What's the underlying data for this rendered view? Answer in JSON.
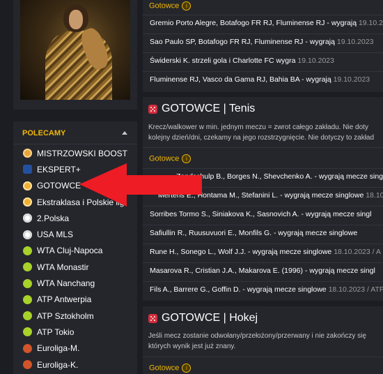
{
  "sidebar": {
    "title": "POLECAMY",
    "items": [
      {
        "label": "MISTRZOWSKI BOOST",
        "icon": "boost-icon"
      },
      {
        "label": "EKSPERT+",
        "icon": "ekspert-icon"
      },
      {
        "label": "GOTOWCE",
        "icon": "gotowce-icon"
      },
      {
        "label": "Ekstraklasa i Polskie lig",
        "icon": "gotowce-icon"
      },
      {
        "label": "2.Polska",
        "icon": "football-icon"
      },
      {
        "label": "USA MLS",
        "icon": "football-icon"
      },
      {
        "label": "WTA Cluj-Napoca",
        "icon": "tennis-ball-icon"
      },
      {
        "label": "WTA Monastir",
        "icon": "tennis-ball-icon"
      },
      {
        "label": "WTA Nanchang",
        "icon": "tennis-ball-icon"
      },
      {
        "label": "ATP Antwerpia",
        "icon": "tennis-ball-icon"
      },
      {
        "label": "ATP Sztokholm",
        "icon": "tennis-ball-icon"
      },
      {
        "label": "ATP Tokio",
        "icon": "tennis-ball-icon"
      },
      {
        "label": "Euroliga-M.",
        "icon": "basketball-icon"
      },
      {
        "label": "Euroliga-K.",
        "icon": "basketball-icon"
      }
    ]
  },
  "football_section": {
    "gotowce_label": "Gotowce",
    "info_glyph": "i",
    "rows": [
      {
        "text": "Gremio Porto Alegre, Botafogo FR RJ, Fluminense RJ - wygrają",
        "date": "19.10.20"
      },
      {
        "text": "Sao Paulo SP, Botafogo FR RJ, Fluminense RJ - wygrają",
        "date": "19.10.2023"
      },
      {
        "text": "Świderski K. strzeli gola i Charlotte FC wygra",
        "date": "19.10.2023"
      },
      {
        "text": "Fluminense RJ, Vasco da Gama RJ, Bahia BA - wygrają",
        "date": "19.10.2023"
      }
    ]
  },
  "tennis_section": {
    "title": "GOTOWCE | Tenis",
    "desc_line1": "Krecz/walkower w min. jednym meczu = zwrot całego zakładu. Nie doty",
    "desc_line2": "kolejny dzień/dni, czekamy na jego rozstrzygnięcie. Nie dotyczy to zakład",
    "gotowce_label": "Gotowce",
    "info_glyph": "i",
    "rows": [
      {
        "text": "Zandschulp B., Borges N., Shevchenko A. - wygrają mecze singl",
        "date": ""
      },
      {
        "text": "Mertens E., Hontama M., Stefanini L. - wygrają mecze singlowe",
        "date": "18.10.2"
      },
      {
        "text": "Sorribes Tormo S., Siniakova K., Sasnovich A. - wygrają mecze singl",
        "date": ""
      },
      {
        "text": "Safiullin R., Ruusuvuori E., Monfils G. - wygrają mecze singlowe",
        "date": ""
      },
      {
        "text": "Rune H., Sonego L., Wolf J.J. - wygrają mecze singlowe",
        "date": "18.10.2023 / A"
      },
      {
        "text": "Masarova R., Cristian J.A., Makarova E. (1996) - wygrają mecze singl",
        "date": ""
      },
      {
        "text": "Fils A., Barrere G., Goffin D. - wygrają mecze singlowe",
        "date": "18.10.2023 / ATP"
      }
    ]
  },
  "hockey_section": {
    "title": "GOTOWCE | Hokej",
    "desc_line1": "Jeśli mecz zostanie odwołany/przełożony/przerwany i nie zakończy się",
    "desc_line2": "których wynik jest już znany.",
    "gotowce_label": "Gotowce",
    "info_glyph": "i"
  },
  "colors": {
    "accent": "#f2b705",
    "arrow": "#ee1c24",
    "background": "#1b1d22",
    "panel": "#24262c"
  }
}
